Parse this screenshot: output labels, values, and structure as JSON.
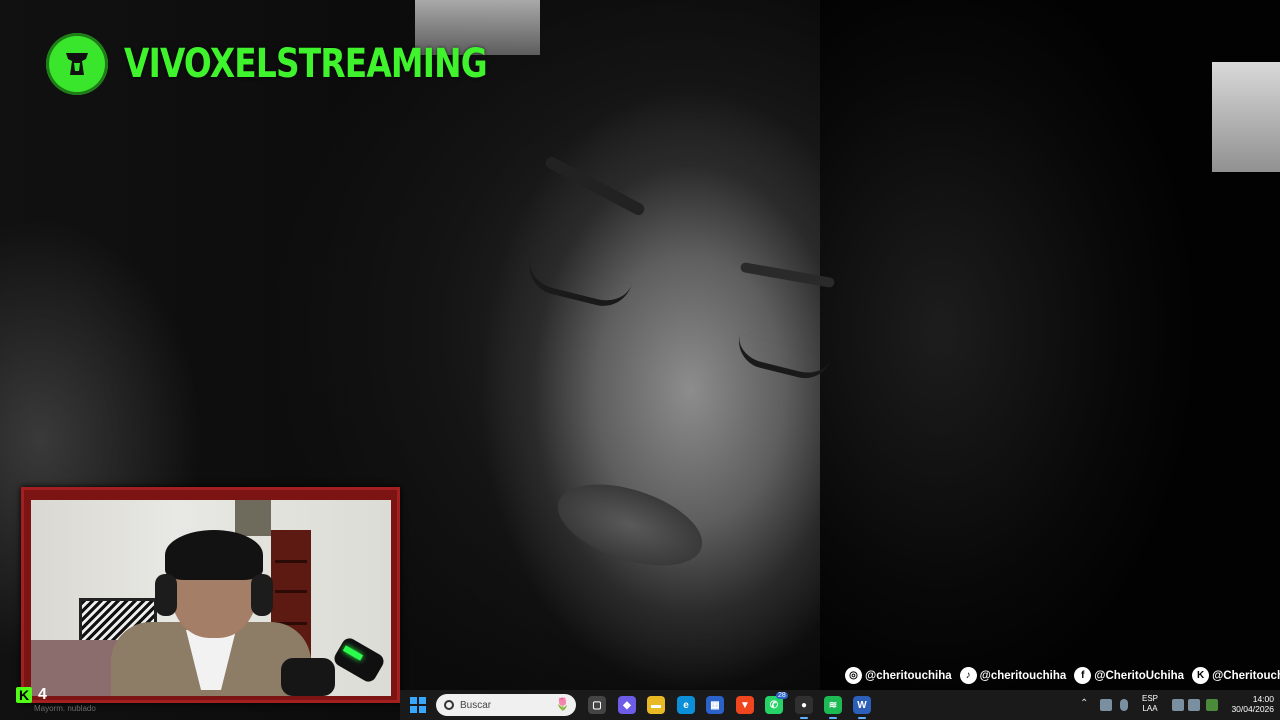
{
  "brand": {
    "name": "VIVOXELSTREAMING",
    "accent_color": "#3ff42c",
    "logo_icon": "vase-logo-icon"
  },
  "webcam": {
    "frame_color": "#7d1414"
  },
  "kick": {
    "icon": "K",
    "viewer_count": "4"
  },
  "weather": {
    "text": "Mayorm. nublado"
  },
  "socials": [
    {
      "icon": "instagram-icon",
      "glyph": "◎",
      "handle": "@cheritouchiha"
    },
    {
      "icon": "tiktok-icon",
      "glyph": "♪",
      "handle": "@cheritouchiha"
    },
    {
      "icon": "facebook-icon",
      "glyph": "f",
      "handle": "@CheritoUchiha"
    },
    {
      "icon": "kick-icon",
      "glyph": "K",
      "handle": "@Cheritouchiha"
    }
  ],
  "taskbar": {
    "search_placeholder": "Buscar",
    "search_decoration": "🌷",
    "whatsapp_badge": "28",
    "language_line1": "ESP",
    "language_line2": "LAA",
    "time": "14:00",
    "date": "30/04/2026",
    "apps": [
      {
        "name": "task-view-icon",
        "glyph": "▢",
        "color": "#444"
      },
      {
        "name": "copilot-icon",
        "glyph": "◆",
        "color": "#6c5ce7"
      },
      {
        "name": "file-explorer-icon",
        "glyph": "▬",
        "color": "#e8b923"
      },
      {
        "name": "edge-icon",
        "glyph": "e",
        "color": "#0a8fd8"
      },
      {
        "name": "store-icon",
        "glyph": "▦",
        "color": "#2a62c9"
      },
      {
        "name": "brave-icon",
        "glyph": "▼",
        "color": "#f0461f"
      },
      {
        "name": "whatsapp-icon",
        "glyph": "✆",
        "color": "#25d366"
      },
      {
        "name": "obs-icon",
        "glyph": "●",
        "color": "#303030"
      },
      {
        "name": "spotify-icon",
        "glyph": "≋",
        "color": "#1db954"
      },
      {
        "name": "word-icon",
        "glyph": "W",
        "color": "#2b5fb8"
      }
    ]
  }
}
